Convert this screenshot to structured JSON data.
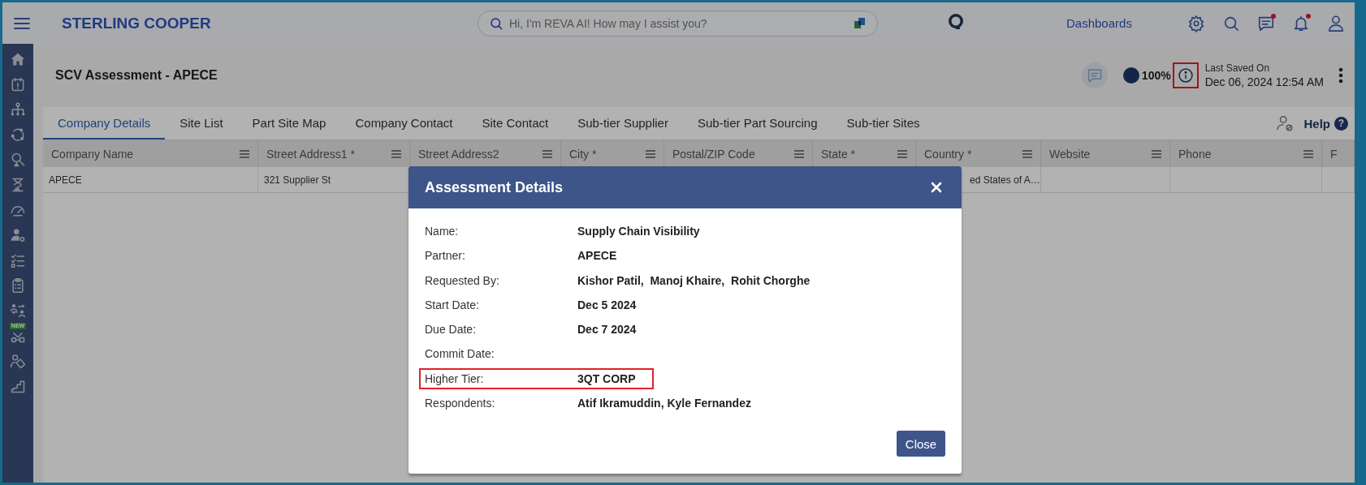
{
  "app": {
    "brand": "STERLING COOPER",
    "search": {
      "placeholder": "Hi, I'm REVA AI! How may I assist you?"
    },
    "nav_link": "Dashboards",
    "icons": [
      {
        "kind": "settings",
        "dot": false
      },
      {
        "kind": "search",
        "dot": false
      },
      {
        "kind": "chat",
        "dot": true
      },
      {
        "kind": "bell",
        "dot": true
      },
      {
        "kind": "user",
        "dot": false
      }
    ]
  },
  "sidebar": {
    "items": [
      {
        "kind": "home"
      },
      {
        "kind": "calendar"
      },
      {
        "kind": "hierarchy"
      },
      {
        "kind": "cycle"
      },
      {
        "kind": "search-alert"
      },
      {
        "kind": "hourglass"
      },
      {
        "kind": "gauge"
      },
      {
        "kind": "user-gear"
      },
      {
        "kind": "checklist"
      },
      {
        "kind": "clipboard"
      },
      {
        "kind": "transfer"
      },
      {
        "kind": "network",
        "badge": "NEW"
      },
      {
        "kind": "user-tag"
      },
      {
        "kind": "stairs"
      }
    ]
  },
  "page": {
    "title": "SCV Assessment - APECE",
    "progress": {
      "label": "100%"
    },
    "info_highlighted": true,
    "last_saved_label": "Last Saved On",
    "last_saved": "Dec 06, 2024 12:54 AM"
  },
  "tabs": [
    {
      "label": "Company Details",
      "selected": true
    },
    {
      "label": "Site List",
      "selected": false
    },
    {
      "label": "Part Site Map",
      "selected": false
    },
    {
      "label": "Company Contact",
      "selected": false
    },
    {
      "label": "Site Contact",
      "selected": false
    },
    {
      "label": "Sub-tier Supplier",
      "selected": false
    },
    {
      "label": "Sub-tier Part Sourcing",
      "selected": false
    },
    {
      "label": "Sub-tier Sites",
      "selected": false
    }
  ],
  "help": {
    "label": "Help",
    "glyph": "?"
  },
  "table": {
    "columns": [
      "Company Name",
      "Street Address1 *",
      "Street Address2",
      "City *",
      "Postal/ZIP Code",
      "State *",
      "Country *",
      "Website",
      "Phone",
      "F"
    ],
    "rows": [
      {
        "cells": [
          {
            "text": "APECE"
          },
          {
            "text": "321 Supplier St"
          },
          {},
          {},
          {},
          {},
          {
            "text": "ed States of A…",
            "clipped": true
          },
          {},
          {},
          {}
        ]
      }
    ]
  },
  "modal": {
    "title": "Assessment Details",
    "fields": [
      {
        "label": "Name:",
        "value": "Supply Chain Visibility",
        "highlighted": false
      },
      {
        "label": "Partner:",
        "value": "APECE",
        "highlighted": false
      },
      {
        "label": "Requested By:",
        "value": "Kishor Patil,  Manoj Khaire,  Rohit Chorghe",
        "highlighted": false
      },
      {
        "label": "Start Date:",
        "value": "Dec 5 2024",
        "highlighted": false
      },
      {
        "label": "Due Date:",
        "value": "Dec 7 2024",
        "highlighted": false
      },
      {
        "label": "Commit Date:",
        "highlighted": false
      },
      {
        "label": "Higher Tier:",
        "value": "3QT CORP",
        "highlighted": true
      },
      {
        "label": "Respondents:",
        "value": "Atif Ikramuddin, Kyle Fernandez",
        "highlighted": false
      }
    ],
    "button": "Close"
  }
}
